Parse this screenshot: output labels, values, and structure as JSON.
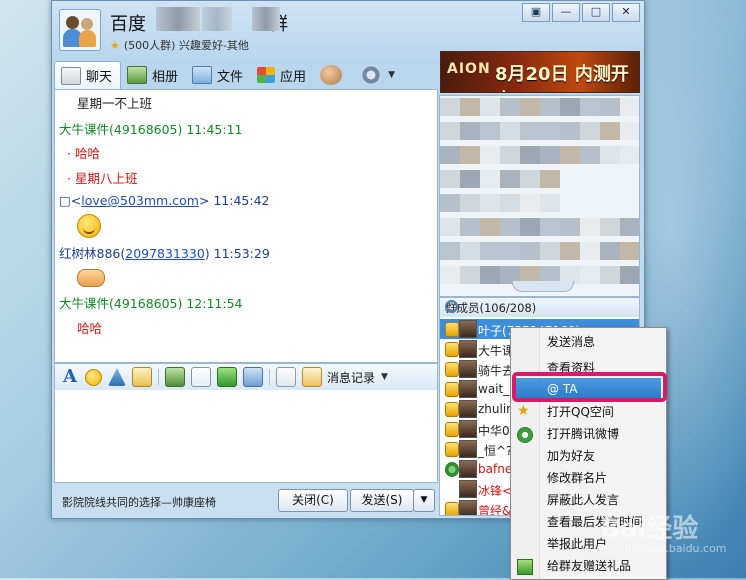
{
  "window": {
    "group_name_prefix": "百度",
    "group_name_suffix": "群",
    "group_subtitle": "(500人群) 兴趣爱好-其他",
    "controls": [
      "▣",
      "—",
      "□",
      "✕"
    ]
  },
  "tabs": [
    {
      "label": "聊天",
      "icon": "chat-icon"
    },
    {
      "label": "相册",
      "icon": "album-icon"
    },
    {
      "label": "文件",
      "icon": "folder-icon"
    },
    {
      "label": "应用",
      "icon": "app-icon"
    }
  ],
  "ad": {
    "logo": "AION",
    "text": "8月20日 内测开启"
  },
  "messages": [
    {
      "text": "星期一不上班",
      "style": "plain"
    },
    {
      "text": "大牛课件(49168605)  11:45:11",
      "style": "green"
    },
    {
      "text": "哈哈",
      "style": "red-bullet"
    },
    {
      "text": "星期八上班",
      "style": "red-bullet"
    },
    {
      "prefix": "□<",
      "link": "love@503mm.com",
      "suffix": ">  11:45:42",
      "style": "blue-link"
    },
    {
      "emoji": "smile-emoji"
    },
    {
      "prefix": "红树林886(",
      "link": "2097831330",
      "suffix": ")  11:53:29",
      "style": "blue-link"
    },
    {
      "emoji": "handshake-emoji"
    },
    {
      "text": "大牛课件(49168605)  12:11:54",
      "style": "green"
    },
    {
      "text": "哈哈",
      "style": "red"
    }
  ],
  "input_toolbar": {
    "history_label": "消息记录"
  },
  "bottom": {
    "slogan": "影院院线共同的选择—帅康座椅",
    "close_label": "关闭(C)",
    "send_label": "发送(S)",
    "dropdown": "▼"
  },
  "members": {
    "header": "群成员(106/208)",
    "items": [
      {
        "name": "叶子(757347160)",
        "selected": true
      },
      {
        "name": "大牛课"
      },
      {
        "name": "骑牛去"
      },
      {
        "name": "wait_99"
      },
      {
        "name": "zhulinlu"
      },
      {
        "name": "中华00"
      },
      {
        "name": "_恒^?<"
      },
      {
        "name": "bafneed",
        "red": true
      },
      {
        "name": "冰锋<o",
        "red": true
      },
      {
        "name": "曾经&",
        "red": true
      }
    ]
  },
  "context_menu": {
    "items": [
      {
        "label": "发送消息"
      },
      {
        "label": "查看资料"
      },
      {
        "label": "@ TA",
        "highlighted": true
      },
      {
        "label": "打开QQ空间",
        "icon": "star-icon"
      },
      {
        "label": "打开腾讯微博",
        "icon": "weibo-icon"
      },
      {
        "label": "加为好友"
      },
      {
        "label": "修改群名片"
      },
      {
        "label": "屏蔽此人发言"
      },
      {
        "label": "查看最后发言时间"
      },
      {
        "label": "举报此用户"
      },
      {
        "label": "给群友赠送礼品",
        "icon": "gift-icon"
      }
    ],
    "highlight_color": "#d81b66"
  },
  "watermark": {
    "main": "Bai经验",
    "sub": "jingyan.baidu.com"
  }
}
